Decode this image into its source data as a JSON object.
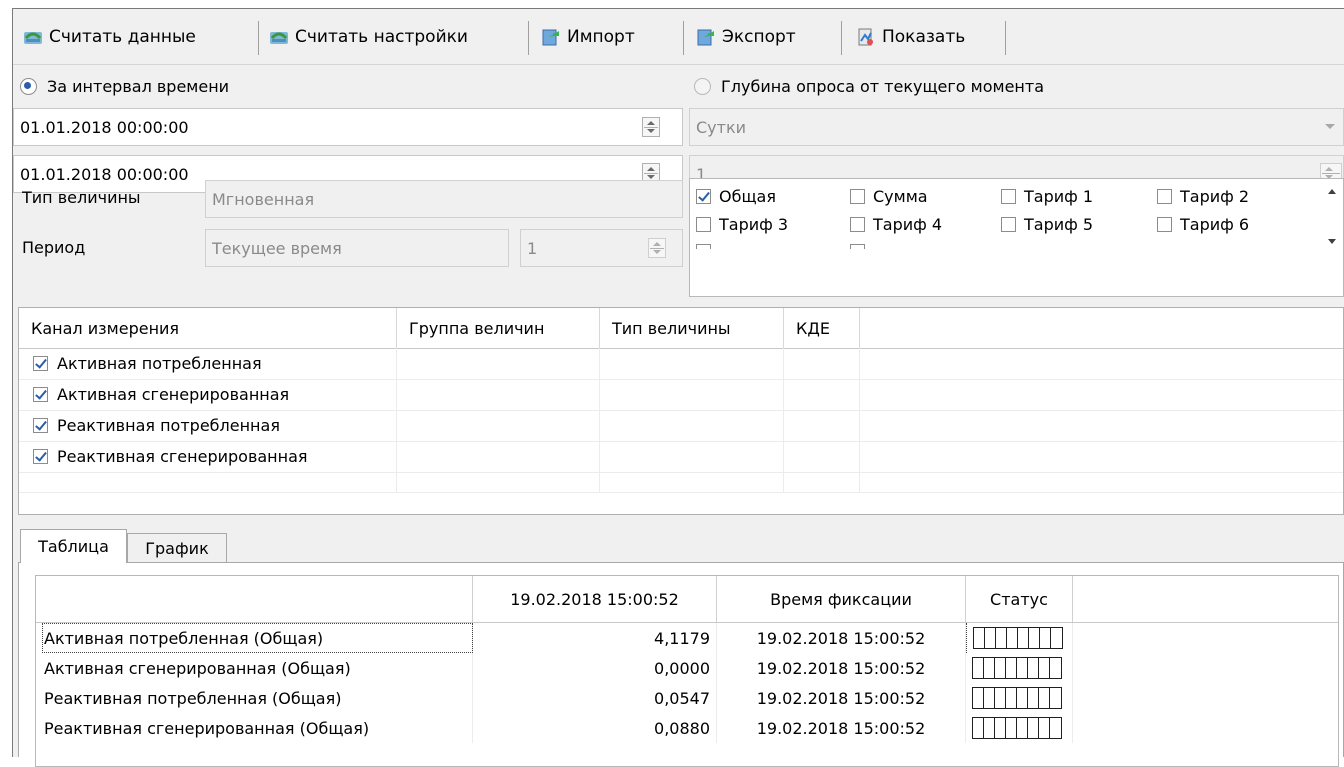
{
  "toolbar": {
    "read_data": "Считать данные",
    "read_settings": "Считать настройки",
    "import": "Импорт",
    "export": "Экспорт",
    "show": "Показать"
  },
  "mode": {
    "interval_label": "За интервал времени",
    "depth_label": "Глубина опроса от текущего момента",
    "selected": "interval"
  },
  "interval": {
    "from": "01.01.2018 00:00:00",
    "to": "01.01.2018 00:00:00"
  },
  "depth": {
    "unit": "Сутки",
    "count": "1"
  },
  "value_type": {
    "label": "Тип величины",
    "value": "Мгновенная"
  },
  "period": {
    "label": "Период",
    "value": "Текущее время",
    "count": "1"
  },
  "tariffs": [
    {
      "label": "Общая",
      "checked": true
    },
    {
      "label": "Сумма",
      "checked": false
    },
    {
      "label": "Тариф 1",
      "checked": false
    },
    {
      "label": "Тариф 2",
      "checked": false
    },
    {
      "label": "Тариф 3",
      "checked": false
    },
    {
      "label": "Тариф 4",
      "checked": false
    },
    {
      "label": "Тариф 5",
      "checked": false
    },
    {
      "label": "Тариф 6",
      "checked": false
    }
  ],
  "channels": {
    "headers": [
      "Канал измерения",
      "Группа величин",
      "Тип величины",
      "КДЕ"
    ],
    "rows": [
      {
        "name": "Активная потребленная",
        "checked": true
      },
      {
        "name": "Активная сгенерированная",
        "checked": true
      },
      {
        "name": "Реактивная потребленная",
        "checked": true
      },
      {
        "name": "Реактивная сгенерированная",
        "checked": true
      }
    ]
  },
  "tabs": [
    {
      "label": "Таблица",
      "active": true
    },
    {
      "label": "График",
      "active": false
    }
  ],
  "results": {
    "headers": [
      "",
      "19.02.2018 15:00:52",
      "Время фиксации",
      "Статус"
    ],
    "rows": [
      {
        "name": "Активная потребленная (Общая)",
        "value": "4,1179",
        "time": "19.02.2018 15:00:52"
      },
      {
        "name": "Активная сгенерированная (Общая)",
        "value": "0,0000",
        "time": "19.02.2018 15:00:52"
      },
      {
        "name": "Реактивная потребленная (Общая)",
        "value": "0,0547",
        "time": "19.02.2018 15:00:52"
      },
      {
        "name": "Реактивная сгенерированная (Общая)",
        "value": "0,0880",
        "time": "19.02.2018 15:00:52"
      }
    ]
  },
  "colors": {
    "accent": "#2c5ea8",
    "toolbar_bg": "#f0f0f0"
  }
}
